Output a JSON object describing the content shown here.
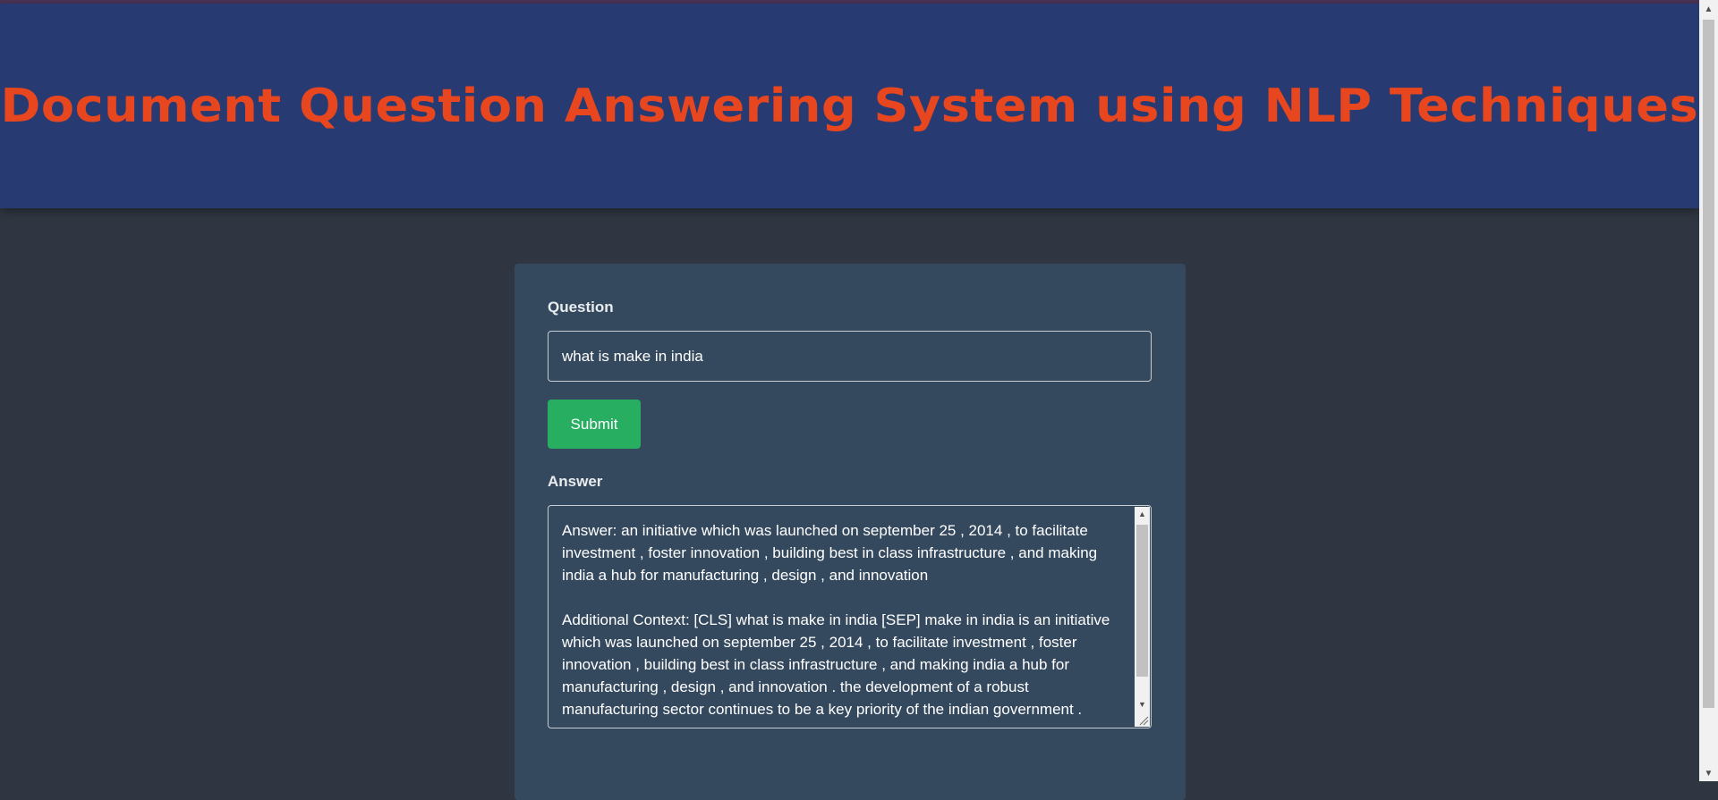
{
  "header": {
    "title": "Document Question Answering System using NLP Techniques"
  },
  "form": {
    "question_label": "Question",
    "question_value": "what is make in india",
    "submit_label": "Submit",
    "answer_label": "Answer",
    "answer_text": "Answer: an initiative which was launched on september 25 , 2014 , to facilitate investment , foster innovation , building best in class infrastructure , and making india a hub for manufacturing , design , and innovation\n\nAdditional Context: [CLS] what is make in india [SEP] make in india is an initiative which was launched on september 25 , 2014 , to facilitate investment , foster innovation , building best in class infrastructure , and making india a hub for manufacturing , design , and innovation . the development of a robust manufacturing sector continues to be a key priority of the indian government ."
  },
  "icons": {
    "scroll_up": "scroll-up-arrow",
    "scroll_down": "scroll-down-arrow",
    "resize": "resize-grip"
  },
  "colors": {
    "header_bg": "#273a72",
    "title": "#e8461e",
    "page_bg": "#303641",
    "card_bg": "#35495e",
    "submit_bg": "#27ae60"
  }
}
